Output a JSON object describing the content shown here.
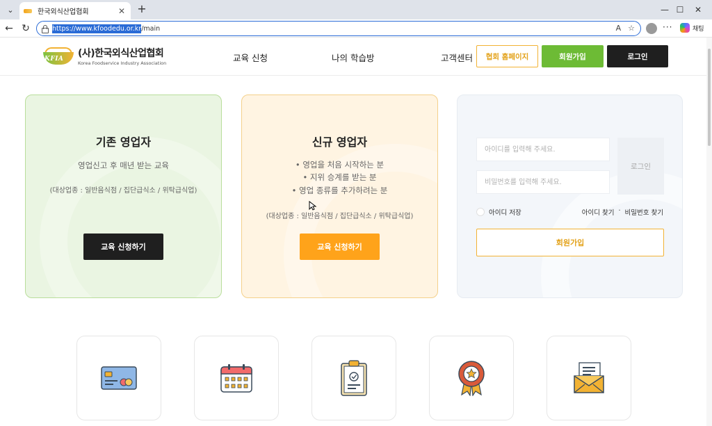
{
  "browser": {
    "tab_title": "한국외식산업협회",
    "url_selected": "https://www.kfoodedu.or.kr",
    "url_rest": "/main",
    "reader_label": "A",
    "copilot_label": "채팅"
  },
  "header": {
    "logo_ko": "(사)한국외식산업협회",
    "logo_en": "Korea Foodservice Industry Association",
    "logo_mark_text": "KFIA",
    "nav": [
      "교육 신청",
      "나의 학습방",
      "고객센터"
    ],
    "home_btn": "협회 홈페이지",
    "join_btn": "회원가입",
    "login_btn": "로그인"
  },
  "cards": {
    "existing": {
      "title": "기존 영업자",
      "desc": "영업신고 후 매년 받는 교육",
      "sub": "(대상업종 : 일반음식점 / 집단급식소 / 위탁급식업)",
      "button": "교육 신청하기"
    },
    "new": {
      "title": "신규 영업자",
      "lines": [
        "• 영업을 처음 시작하는 분",
        "• 지위 승계를 받는 분",
        "• 영업 종류를 추가하려는 분"
      ],
      "sub": "(대상업종 : 일반음식점 / 집단급식소 / 위탁급식업)",
      "button": "교육 신청하기"
    },
    "login": {
      "id_placeholder": "아이디를 입력해 주세요.",
      "pw_placeholder": "비밀번호를 입력해 주세요.",
      "submit": "로그인",
      "save_id": "아이디 저장",
      "find_id": "아이디 찾기",
      "separator": "·",
      "find_pw": "비밀번호 찾기",
      "join": "회원가입"
    }
  },
  "quick_menu_icons": [
    "card-icon",
    "calendar-icon",
    "clipboard-icon",
    "award-icon",
    "mail-icon"
  ],
  "colors": {
    "green": "#6dbb35",
    "orange": "#ffa31a",
    "gold": "#f2b233",
    "dark": "#1f1f1f"
  }
}
